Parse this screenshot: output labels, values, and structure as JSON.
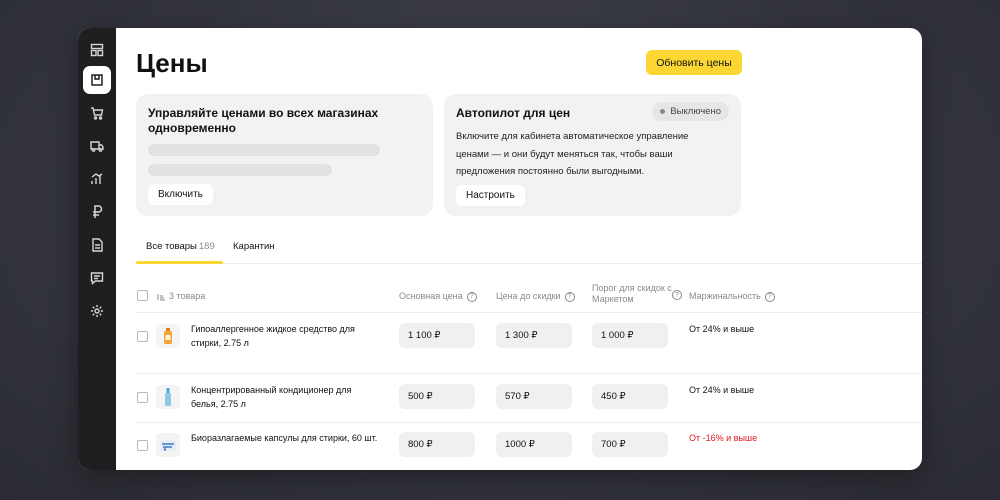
{
  "page": {
    "title": "Цены",
    "update_button": "Обновить цены"
  },
  "sidebar": {
    "items": [
      {
        "icon": "dashboard-icon"
      },
      {
        "icon": "box-icon",
        "active": true
      },
      {
        "icon": "cart-icon"
      },
      {
        "icon": "truck-icon"
      },
      {
        "icon": "analytics-icon"
      },
      {
        "icon": "ruble-icon"
      },
      {
        "icon": "document-icon"
      },
      {
        "icon": "chat-icon"
      },
      {
        "icon": "gear-icon"
      }
    ]
  },
  "cards": {
    "multistore": {
      "title": "Управляйте ценами во всех магазинах одновременно",
      "button": "Включить"
    },
    "autopilot": {
      "title": "Автопилот для цен",
      "status": "Выключено",
      "description": "Включите для кабинета автоматическое управление ценами — и они будут меняться так, чтобы ваши предложения постоянно были выгодными.",
      "button": "Настроить"
    }
  },
  "tabs": [
    {
      "label": "Все товары",
      "count": "189",
      "active": true
    },
    {
      "label": "Карантин"
    }
  ],
  "table": {
    "selection_count": "3 товара",
    "columns": {
      "base_price": "Основная цена",
      "price_before_discount": "Цена до скидки",
      "discount_threshold": "Порог для скидок с Маркетом",
      "margin": "Маржинальность"
    },
    "rows": [
      {
        "name": "Гипоаллергенное жидкое средство для стирки, 2.75 л",
        "base_price": "1 100 ₽",
        "price_before_discount": "1 300 ₽",
        "discount_threshold": "1 000 ₽",
        "margin": "От 24% и выше",
        "margin_negative": false
      },
      {
        "name": "Концентрированный кондиционер для белья, 2.75 л",
        "base_price": "500 ₽",
        "price_before_discount": "570 ₽",
        "discount_threshold": "450 ₽",
        "margin": "От 24% и выше",
        "margin_negative": false
      },
      {
        "name": "Биоразлагаемые капсулы для стирки, 60 шт.",
        "base_price": "800 ₽",
        "price_before_discount": "1000 ₽",
        "discount_threshold": "700 ₽",
        "margin": "От -16% и выше",
        "margin_negative": true
      }
    ]
  },
  "colors": {
    "accent": "#fcd733",
    "sidebar": "#1f1f21",
    "negative": "#e0171d"
  }
}
